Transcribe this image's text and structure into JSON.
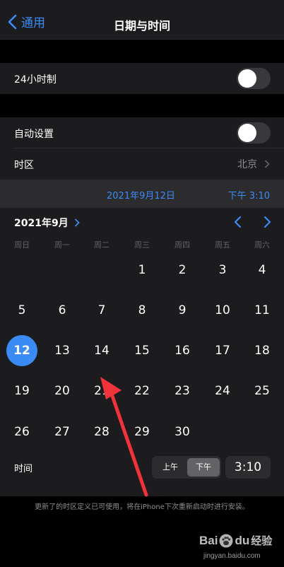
{
  "nav": {
    "back_label": "通用",
    "title": "日期与时间"
  },
  "settings": {
    "hour24_label": "24小时制",
    "auto_label": "自动设置",
    "timezone_label": "时区",
    "timezone_value": "北京"
  },
  "datetime": {
    "date": "2021年9月12日",
    "time": "下午 3:10"
  },
  "calendar": {
    "month_label": "2021年9月",
    "weekdays": [
      "周日",
      "周一",
      "周二",
      "周三",
      "周四",
      "周五",
      "周六"
    ],
    "days": [
      "1",
      "2",
      "3",
      "4",
      "5",
      "6",
      "7",
      "8",
      "9",
      "10",
      "11",
      "12",
      "13",
      "14",
      "15",
      "16",
      "17",
      "18",
      "19",
      "20",
      "21",
      "22",
      "23",
      "24",
      "25",
      "26",
      "27",
      "28",
      "29",
      "30"
    ],
    "selected_day": "12"
  },
  "time_picker": {
    "label": "时间",
    "am": "上午",
    "pm": "下午",
    "value": "3:10"
  },
  "footer": "更新了的时区定义已可使用，将在iPhone下次重新启动时进行安装。",
  "watermark": {
    "brand": "Bai",
    "brand2": "du",
    "cn": "经验",
    "url": "jingyan.baidu.com"
  },
  "colors": {
    "accent": "#3b8bf5",
    "annotation_arrow": "#f0333a"
  }
}
